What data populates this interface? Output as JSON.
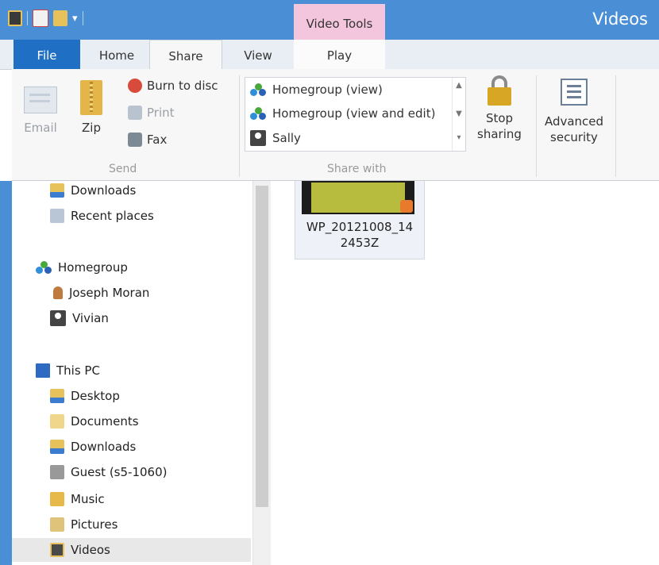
{
  "window": {
    "title": "Videos"
  },
  "ribbon_tabs": {
    "contextual_group": "Video Tools",
    "file": "File",
    "home": "Home",
    "share": "Share",
    "view": "View",
    "play": "Play"
  },
  "share_tab": {
    "send": {
      "label": "Send",
      "email": "Email",
      "zip": "Zip",
      "burn": "Burn to disc",
      "print": "Print",
      "fax": "Fax"
    },
    "share_with": {
      "label": "Share with",
      "items": [
        "Homegroup (view)",
        "Homegroup (view and edit)",
        "Sally"
      ]
    },
    "stop_sharing": {
      "line1": "Stop",
      "line2": "sharing"
    },
    "advanced_security": {
      "line1": "Advanced",
      "line2": "security"
    }
  },
  "nav": {
    "downloads_top": "Downloads",
    "recent_places": "Recent places",
    "homegroup": "Homegroup",
    "joseph": "Joseph Moran",
    "vivian": "Vivian",
    "this_pc": "This PC",
    "desktop": "Desktop",
    "documents": "Documents",
    "downloads": "Downloads",
    "guest": "Guest (s5-1060)",
    "music": "Music",
    "pictures": "Pictures",
    "videos": "Videos"
  },
  "content": {
    "file_name_line1": "WP_20121008_14",
    "file_name_line2": "2453Z"
  },
  "colors": {
    "accent": "#4a8fd6",
    "file_tab": "#1f6fc5",
    "contextual_tab": "#f4c6de"
  }
}
